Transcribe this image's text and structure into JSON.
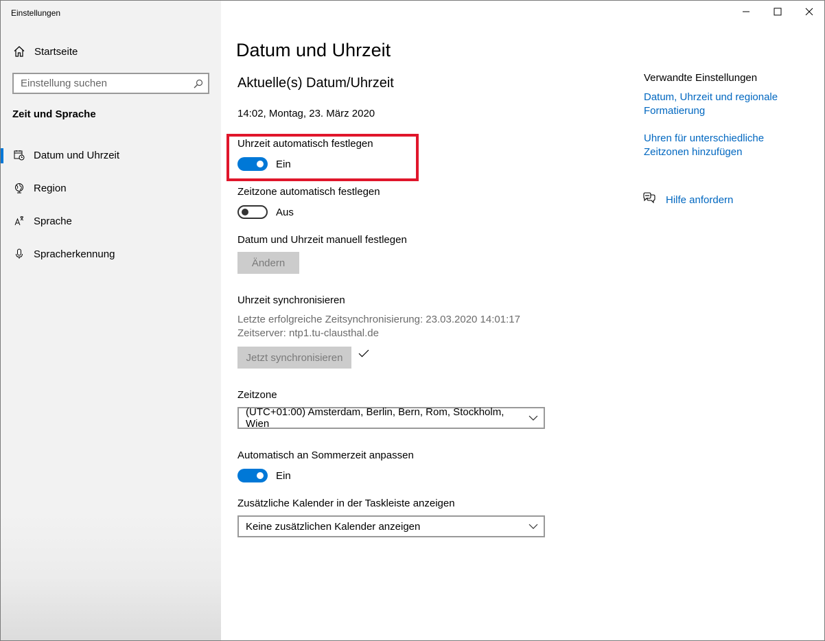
{
  "window": {
    "title": "Einstellungen"
  },
  "sidebar": {
    "home_label": "Startseite",
    "search_placeholder": "Einstellung suchen",
    "section_title": "Zeit und Sprache",
    "items": [
      {
        "label": "Datum und Uhrzeit",
        "icon": "calendar-clock-icon",
        "active": true
      },
      {
        "label": "Region",
        "icon": "globe-icon",
        "active": false
      },
      {
        "label": "Sprache",
        "icon": "language-icon",
        "active": false
      },
      {
        "label": "Spracherkennung",
        "icon": "microphone-icon",
        "active": false
      }
    ]
  },
  "main": {
    "page_title": "Datum und Uhrzeit",
    "current_heading": "Aktuelle(s) Datum/Uhrzeit",
    "current_datetime": "14:02, Montag, 23. März 2020",
    "auto_time": {
      "label": "Uhrzeit automatisch festlegen",
      "state": "Ein",
      "on": true
    },
    "auto_zone": {
      "label": "Zeitzone automatisch festlegen",
      "state": "Aus",
      "on": false
    },
    "manual": {
      "label": "Datum und Uhrzeit manuell festlegen",
      "button": "Ändern"
    },
    "sync": {
      "label": "Uhrzeit synchronisieren",
      "last_sync": "Letzte erfolgreiche Zeitsynchronisierung: 23.03.2020 14:01:17",
      "server": "Zeitserver: ntp1.tu-clausthal.de",
      "button": "Jetzt synchronisieren"
    },
    "timezone": {
      "label": "Zeitzone",
      "value": "(UTC+01:00) Amsterdam, Berlin, Bern, Rom, Stockholm, Wien"
    },
    "dst": {
      "label": "Automatisch an Sommerzeit anpassen",
      "state": "Ein",
      "on": true
    },
    "calendar": {
      "label": "Zusätzliche Kalender in der Taskleiste anzeigen",
      "value": "Keine zusätzlichen Kalender anzeigen"
    }
  },
  "related": {
    "heading": "Verwandte Einstellungen",
    "links": [
      "Datum, Uhrzeit und regionale Formatierung",
      "Uhren für unterschiedliche Zeitzonen hinzufügen"
    ],
    "help": "Hilfe anfordern"
  },
  "colors": {
    "accent": "#0078d7",
    "link": "#0067c0",
    "highlight": "#e0162b"
  }
}
